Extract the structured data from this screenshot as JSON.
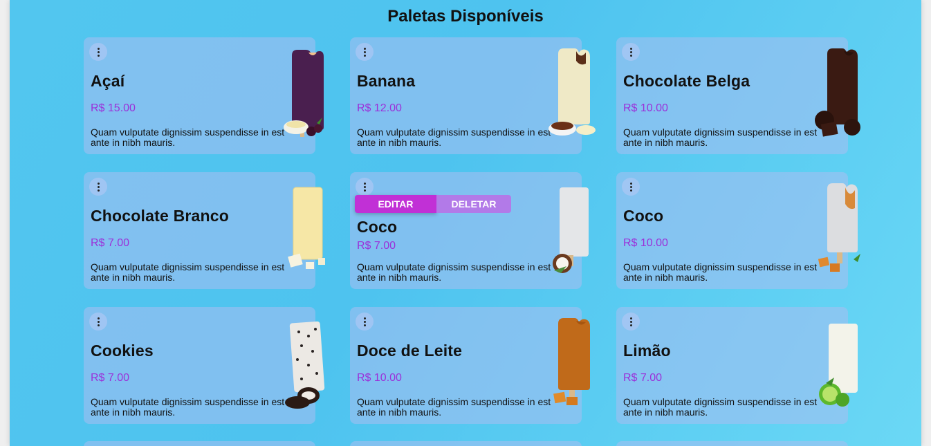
{
  "page": {
    "title": "Paletas Disponíveis"
  },
  "actions": {
    "edit_label": "EDITAR",
    "delete_label": "DELETAR"
  },
  "cards": [
    {
      "name": "Açaí",
      "price": "R$ 15.00",
      "description": "Quam vulputate dignissim suspendisse in est ante in nibh mauris.",
      "color": "#4a1f4f",
      "side": "berry-bowl"
    },
    {
      "name": "Banana",
      "price": "R$ 12.00",
      "description": "Quam vulputate dignissim suspendisse in est ante in nibh mauris.",
      "color": "#efe9c6",
      "side": "banana"
    },
    {
      "name": "Chocolate Belga",
      "price": "R$ 10.00",
      "description": "Quam vulputate dignissim suspendisse in est ante in nibh mauris.",
      "color": "#3a1a12",
      "side": "chocolate"
    },
    {
      "name": "Chocolate Branco",
      "price": "R$ 7.00",
      "description": "Quam vulputate dignissim suspendisse in est ante in nibh mauris.",
      "color": "#f6e7a6",
      "side": "white-choc"
    },
    {
      "name": "Coco",
      "price": "R$ 7.00",
      "description": "Quam vulputate dignissim suspendisse in est ante in nibh mauris.",
      "color": "#e4e6e8",
      "side": "coconut"
    },
    {
      "name": "Coco",
      "price": "R$ 10.00",
      "description": "Quam vulputate dignissim suspendisse in est ante in nibh mauris.",
      "color": "#dcdde0",
      "side": "caramel"
    },
    {
      "name": "Cookies",
      "price": "R$ 7.00",
      "description": "Quam vulputate dignissim suspendisse in est ante in nibh mauris.",
      "color": "#ece9e4",
      "side": "oreo"
    },
    {
      "name": "Doce de Leite",
      "price": "R$ 10.00",
      "description": "Quam vulputate dignissim suspendisse in est ante in nibh mauris.",
      "color": "#c06a1a",
      "side": "caramel"
    },
    {
      "name": "Limão",
      "price": "R$ 7.00",
      "description": "Quam vulputate dignissim suspendisse in est ante in nibh mauris.",
      "color": "#f3f3ea",
      "side": "lime"
    }
  ],
  "colors": {
    "background": "#4ec3ef",
    "price": "#9b30d9",
    "edit": "#c130d6",
    "delete": "#b27ae8"
  }
}
